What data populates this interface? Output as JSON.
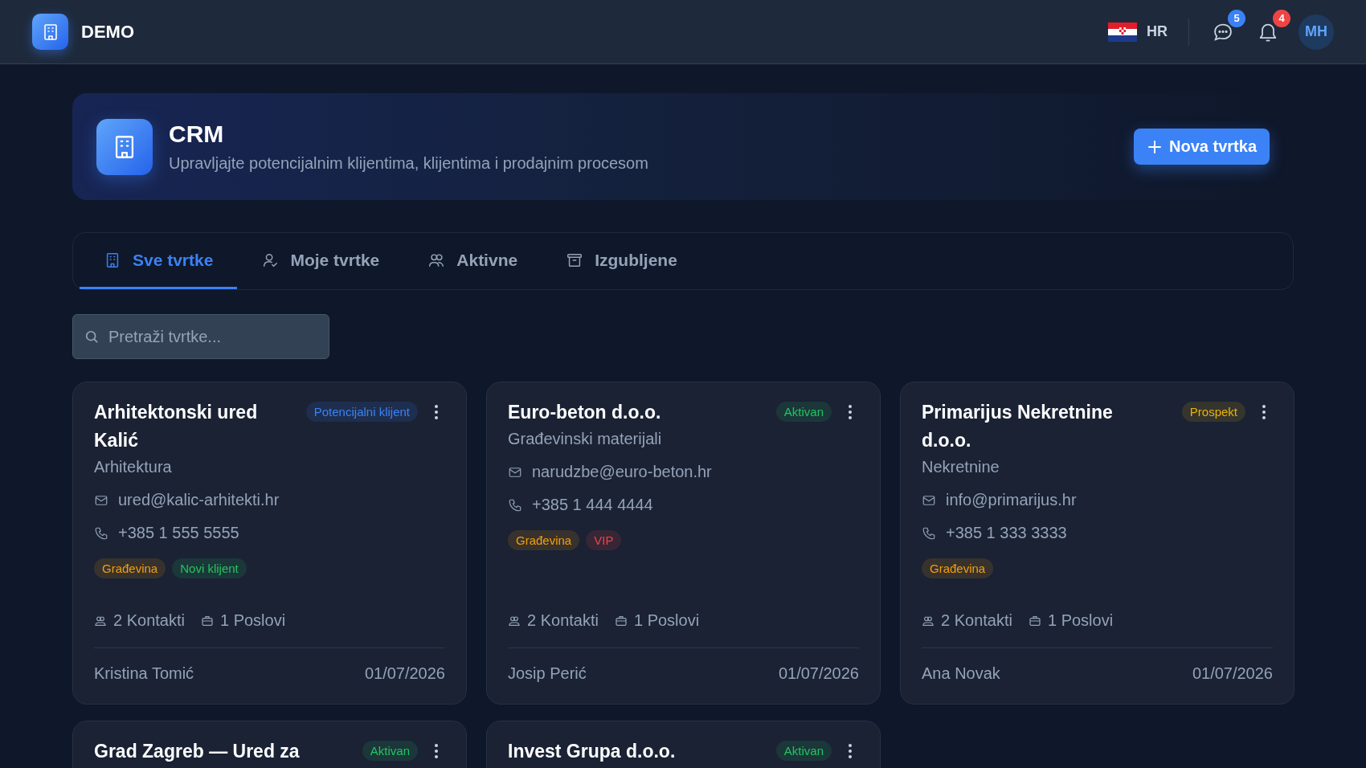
{
  "app": {
    "name": "DEMO"
  },
  "topbar": {
    "language": "HR",
    "messages_badge": "5",
    "notifications_badge": "4",
    "avatar": "MH"
  },
  "hero": {
    "title": "CRM",
    "subtitle": "Upravljajte potencijalnim klijentima, klijentima i prodajnim procesom",
    "button": "Nova tvrtka"
  },
  "tabs": [
    {
      "label": "Sve tvrtke",
      "selected": true
    },
    {
      "label": "Moje tvrtke",
      "selected": false
    },
    {
      "label": "Aktivne",
      "selected": false
    },
    {
      "label": "Izgubljene",
      "selected": false
    }
  ],
  "search": {
    "placeholder": "Pretraži tvrtke..."
  },
  "companies": [
    {
      "name": "Arhitektonski ured Kalić",
      "status": {
        "label": "Potencijalni klijent",
        "color": "#3b82f6"
      },
      "industry": "Arhitektura",
      "email": "ured@kalic-arhitekti.hr",
      "phone": "+385 1 555 5555",
      "tags": [
        {
          "label": "Građevina",
          "color": "#f59e0b"
        },
        {
          "label": "Novi klijent",
          "color": "#22c55e"
        }
      ],
      "contacts": "2 Kontakti",
      "deals": "1 Poslovi",
      "owner": "Kristina Tomić",
      "date": "01/07/2026"
    },
    {
      "name": "Euro-beton d.o.o.",
      "status": {
        "label": "Aktivan",
        "color": "#22c55e"
      },
      "industry": "Građevinski materijali",
      "email": "narudzbe@euro-beton.hr",
      "phone": "+385 1 444 4444",
      "tags": [
        {
          "label": "Građevina",
          "color": "#f59e0b"
        },
        {
          "label": "VIP",
          "color": "#ef4444"
        }
      ],
      "contacts": "2 Kontakti",
      "deals": "1 Poslovi",
      "owner": "Josip Perić",
      "date": "01/07/2026"
    },
    {
      "name": "Primarijus Nekretnine d.o.o.",
      "status": {
        "label": "Prospekt",
        "color": "#eab308"
      },
      "industry": "Nekretnine",
      "email": "info@primarijus.hr",
      "phone": "+385 1 333 3333",
      "tags": [
        {
          "label": "Građevina",
          "color": "#f59e0b"
        }
      ],
      "contacts": "2 Kontakti",
      "deals": "1 Poslovi",
      "owner": "Ana Novak",
      "date": "01/07/2026"
    },
    {
      "name": "Grad Zagreb — Ured za",
      "status": {
        "label": "Aktivan",
        "color": "#22c55e"
      }
    },
    {
      "name": "Invest Grupa d.o.o.",
      "status": {
        "label": "Aktivan",
        "color": "#22c55e"
      }
    }
  ]
}
